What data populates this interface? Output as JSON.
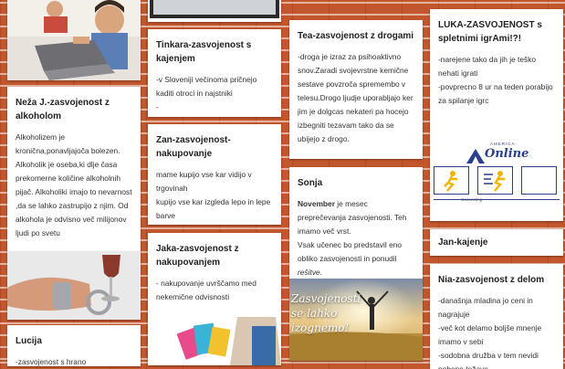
{
  "colors": {
    "brick": "#c2562c",
    "mortar": "#ffffff",
    "card": "#ffffff",
    "text": "#333333",
    "title": "#222222",
    "aol_blue": "#2b3f8f"
  },
  "neza": {
    "title": "Neža J.-zasvojenost z alkoholom",
    "body": "Alkoholizem je kronična,ponavljajoča bolezen. Alkoholik je oseba,ki dlje časa prekomerne količine alkoholnih pijač. Alkoholiki imajo to nevarnost ,da se lahko zastrupijo z njim. Od alkohola je odvisno več milijonov ljudi po svetu"
  },
  "lucija": {
    "title": "Lucija",
    "body": "-zasvojenost s hrano"
  },
  "tinkara": {
    "title": "Tinkara-zasvojenost s kajenjem",
    "body": "-v Sloveniji večinoma pričnejo kaditi otroci in najstniki",
    "dash": "-"
  },
  "zan": {
    "title": "Zan-zasvojenost-nakupovanje",
    "line1": "mame kupijo vse kar vidijo v trgovinah",
    "line2": "kupijo vse kar izgleda lepo in lepe barve"
  },
  "jaka": {
    "title": "Jaka-zasvojenost z nakupovanjem",
    "body": "- nakupovanje uvrščamo med nekemične odvisnosti"
  },
  "drogami": {
    "title": "Tea-zasvojenost z drogami",
    "body": "-droga je izraz za psihoaktivno snov.Zaradi  svojevrstne kemične sestave povzroča spremembo v telesu.Drogo ljudje uporabljajo  ker jim je dolgcas nekateri pa hocejo izbegniti tezavam  tako da se ubijejo z drogo."
  },
  "sonja": {
    "title": "Sonja",
    "bold": "November",
    "part1": " je mesec preprečevanja zasvojenosti. Teh imamo več vrst.",
    "part2": "Vsak učenec bo predstavil eno obliko zasvojenosti in ponudil ",
    "italic": "rešitve",
    "end": ".",
    "image_text": "Zasvojenosti se lahko izognemo!"
  },
  "luka": {
    "title": "LUKA-ZASVOJENOST s spletnimi igrAmi!?!",
    "line1": "-narejene tako da jih je teško nehati igrati",
    "line2": "-povprecno 8 ur na teden porabijo za spilanje igrc",
    "logo_top": "AMERICA",
    "logo_word": "Online",
    "caption": "Connecting"
  },
  "jan": {
    "title": "Jan-kajenje"
  },
  "nia": {
    "title": "Nia-zasvojenost z delom",
    "line1": "-današnja mladina jo ceni in nagrajuje",
    "line2": "-več kot delamo boljše mnenje imamo v sebi",
    "line3": "-sodobna družba v tem nevidi nobene težave"
  }
}
